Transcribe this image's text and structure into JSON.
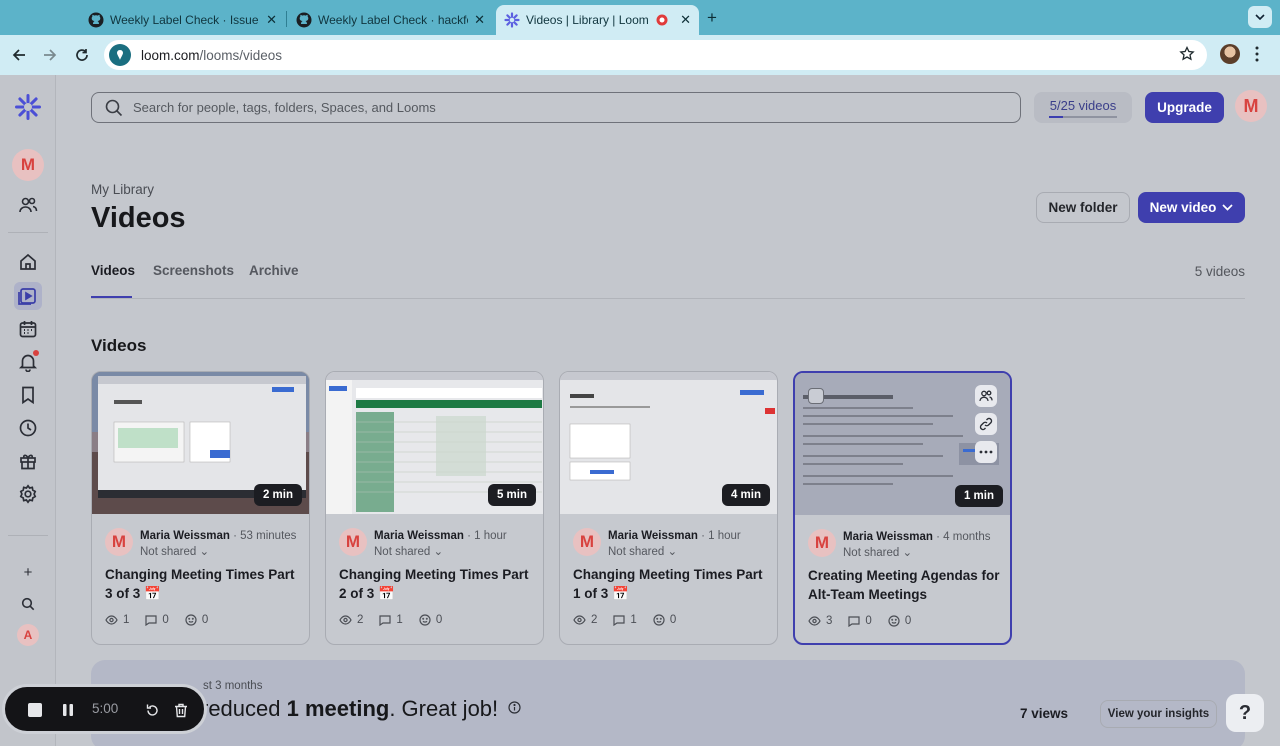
{
  "browser": {
    "tabs": [
      {
        "title": "Weekly Label Check · Issue #",
        "icon": "github-icon"
      },
      {
        "title": "Weekly Label Check · hackfo",
        "icon": "github-icon"
      },
      {
        "title": "Videos | Library | Loom",
        "icon": "loom-icon",
        "active": true
      }
    ],
    "url_domain": "loom.com",
    "url_path": "/looms/videos"
  },
  "search": {
    "placeholder": "Search for people, tags, folders, Spaces, and Looms"
  },
  "quota": {
    "label": "5/25 videos",
    "used": 5,
    "total": 25
  },
  "upgrade_label": "Upgrade",
  "user_initial": "M",
  "sidebar": {
    "workspace_initial": "M",
    "bottom_initial": "A"
  },
  "header": {
    "breadcrumb": "My Library",
    "title": "Videos",
    "new_folder_label": "New folder",
    "new_video_label": "New video"
  },
  "page_tabs": [
    {
      "label": "Videos",
      "active": true
    },
    {
      "label": "Screenshots",
      "active": false
    },
    {
      "label": "Archive",
      "active": false
    }
  ],
  "video_count": "5 videos",
  "section_title": "Videos",
  "videos": [
    {
      "duration": "2 min",
      "author_initial": "M",
      "author": "Maria Weissman",
      "age": "53 minutes",
      "sharing": "Not shared",
      "title": "Changing Meeting Times Part 3 of 3 📅",
      "views": "1",
      "comments": "0",
      "reactions": "0"
    },
    {
      "duration": "5 min",
      "author_initial": "M",
      "author": "Maria Weissman",
      "age": "1 hour",
      "sharing": "Not shared",
      "title": "Changing Meeting Times Part 2 of 3 📅",
      "views": "2",
      "comments": "1",
      "reactions": "0"
    },
    {
      "duration": "4 min",
      "author_initial": "M",
      "author": "Maria Weissman",
      "age": "1 hour",
      "sharing": "Not shared",
      "title": "Changing Meeting Times Part 1 of 3 📅",
      "views": "2",
      "comments": "1",
      "reactions": "0"
    },
    {
      "duration": "1 min",
      "author_initial": "M",
      "author": "Maria Weissman",
      "age": "4 months",
      "sharing": "Not shared",
      "title": "Creating Meeting Agendas for Alt-Team Meetings",
      "views": "3",
      "comments": "0",
      "reactions": "0"
    }
  ],
  "insights": {
    "subtitle": "st 3 months",
    "prefix": "reduced ",
    "highlight": "1 meeting",
    "suffix": ". Great job!",
    "views": "7 views",
    "button_label": "View your insights"
  },
  "help_label": "?",
  "recorder": {
    "time": "5:00"
  }
}
